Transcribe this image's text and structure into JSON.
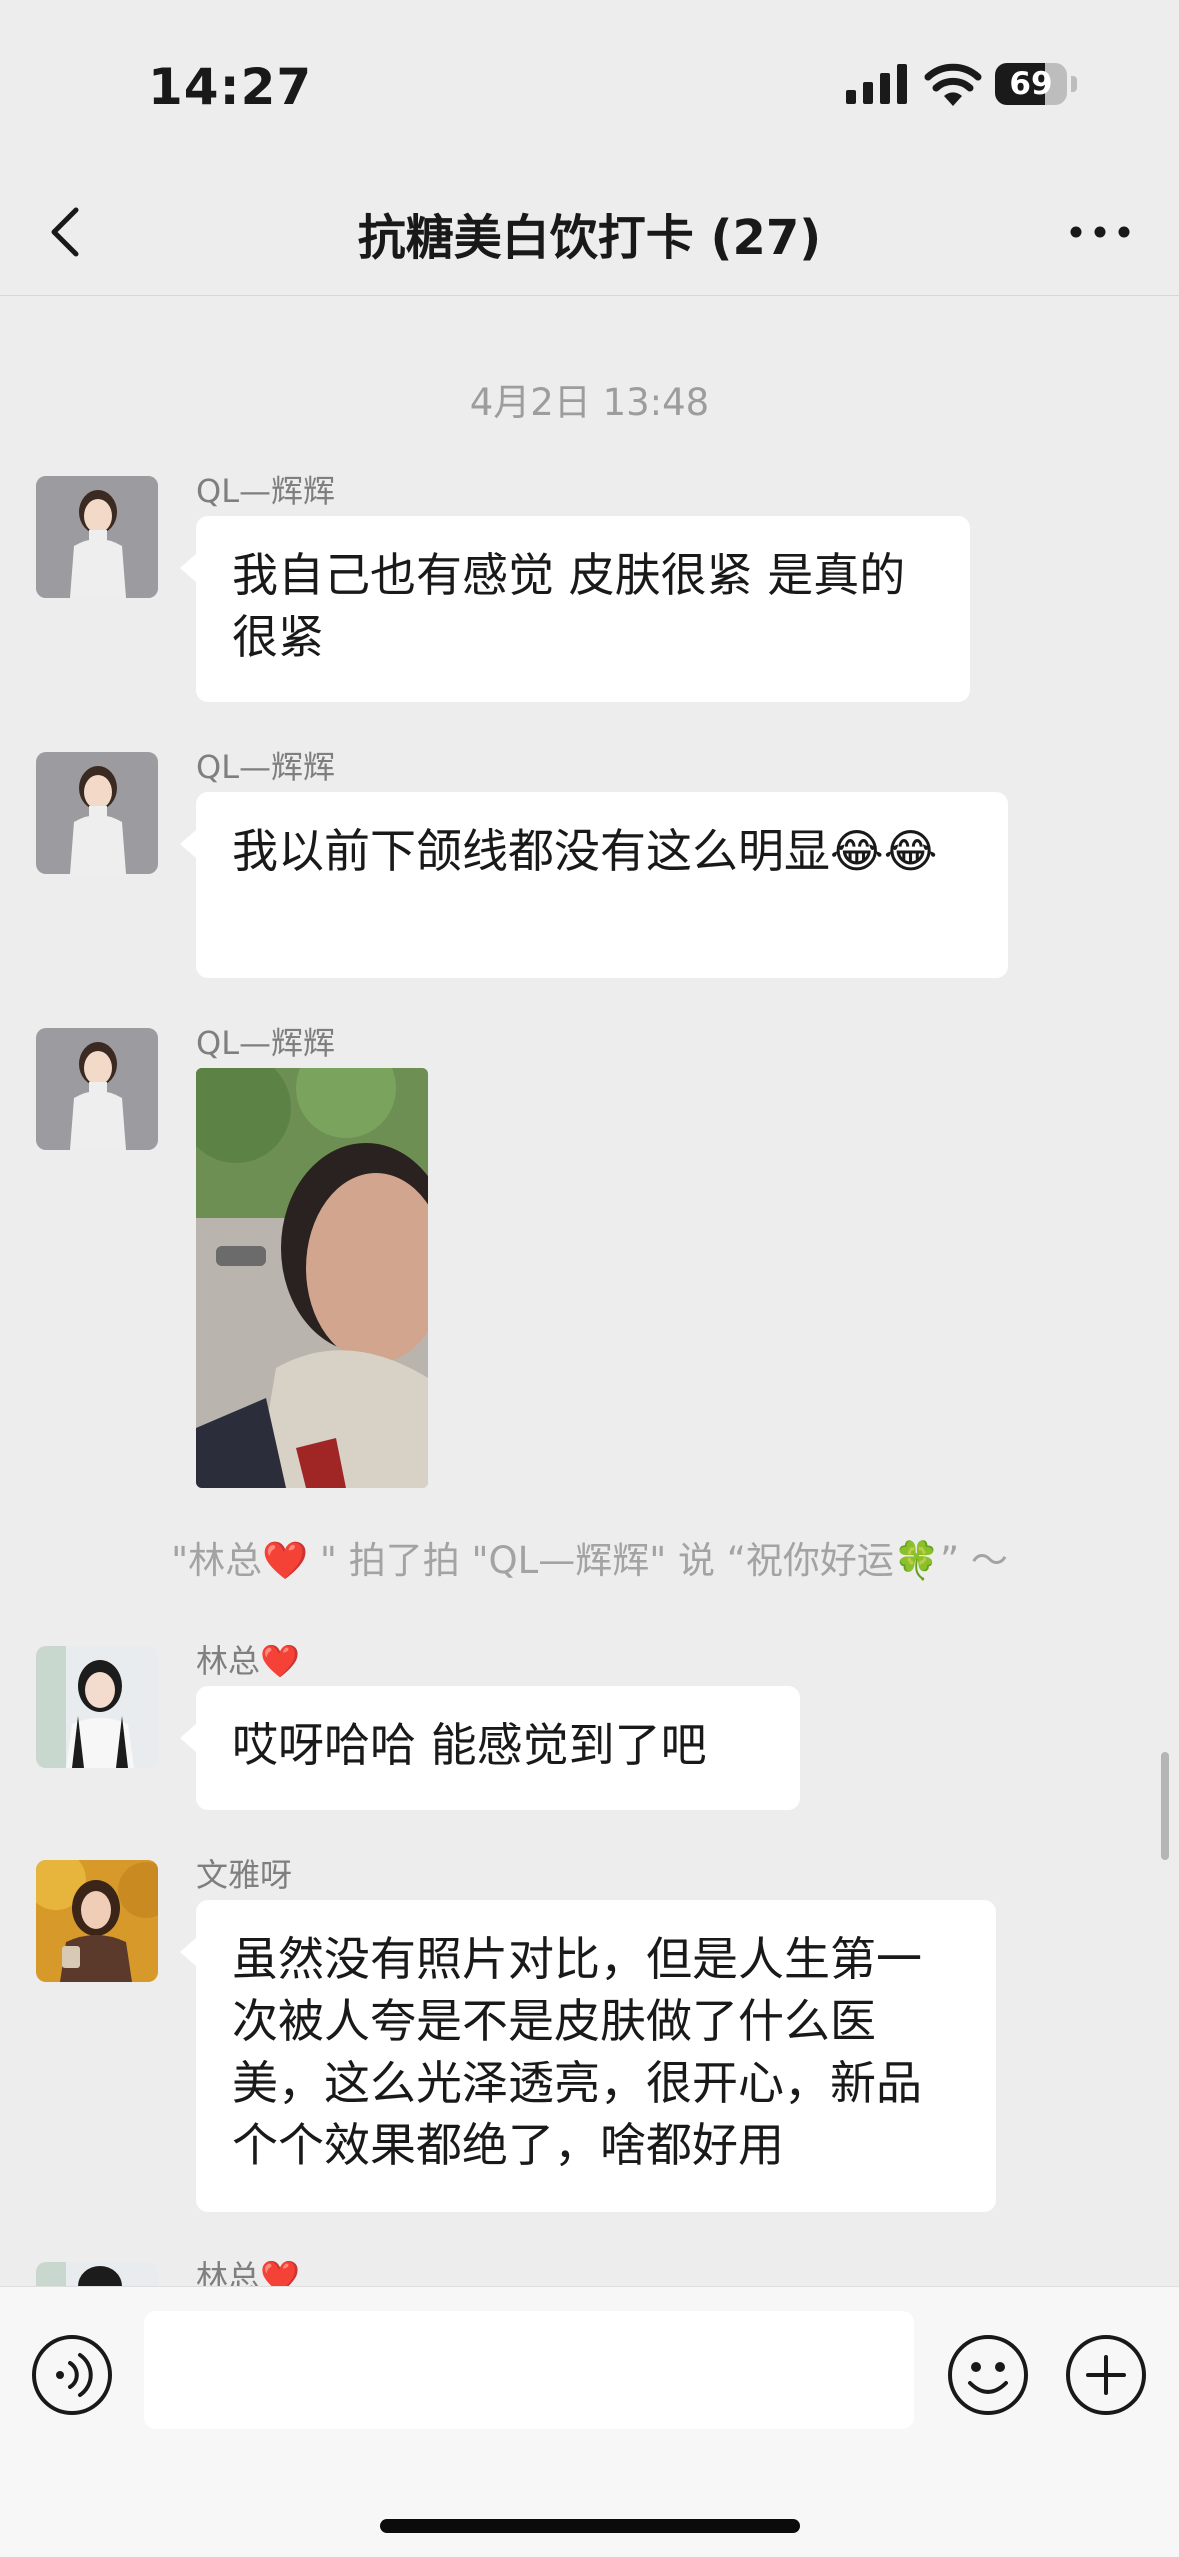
{
  "status_bar": {
    "time": "14:27",
    "battery": "69",
    "battery_level": 0.69
  },
  "nav": {
    "title": "抗糖美白饮打卡 (27)"
  },
  "chat": {
    "timestamp": "4月2日 13:48",
    "messages": [
      {
        "sender": "QL—辉辉",
        "text": "我自己也有感觉 皮肤很紧 是真的很紧"
      },
      {
        "sender": "QL—辉辉",
        "text": "我以前下颌线都没有这么明显😂😂"
      },
      {
        "sender": "QL—辉辉",
        "type": "image"
      },
      {
        "sender": "林总❤️",
        "text": "哎呀哈哈 能感觉到了吧"
      },
      {
        "sender": "文雅呀",
        "text": "虽然没有照片对比，但是人生第一次被人夸是不是皮肤做了什么医美，这么光泽透亮，很开心，新品个个效果都绝了，啥都好用"
      },
      {
        "sender": "林总❤️"
      }
    ],
    "system_note": "\"林总❤️ \" 拍了拍 \"QL—辉辉\" 说 “祝你好运🍀” ～"
  },
  "input_bar": {
    "value": ""
  },
  "icons": {
    "back": "chevron-left-icon",
    "more": "more-dots-icon",
    "voice": "voice-icon",
    "emoji": "emoji-icon",
    "plus": "plus-icon"
  }
}
